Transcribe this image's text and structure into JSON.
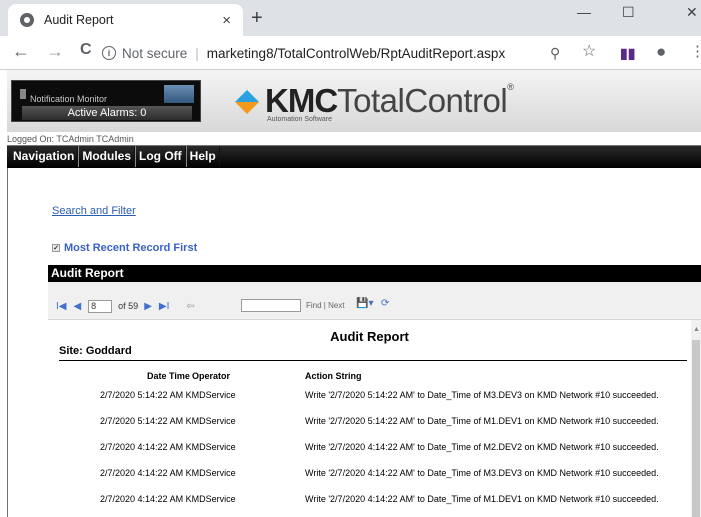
{
  "browser": {
    "tab_title": "Audit Report",
    "new_tab": "+",
    "url_security": "Not secure",
    "url": "marketing8/TotalControlWeb/RptAuditReport.aspx"
  },
  "header": {
    "notification_label": "Notification Monitor",
    "active_alarms": "Active Alarms: 0",
    "brand_bold": "KMC",
    "brand_light": "TotalControl",
    "brand_sub": "Automation Software"
  },
  "logged_on": "Logged On: TCAdmin TCAdmin",
  "menu": [
    "Navigation",
    "Modules",
    "Log Off",
    "Help"
  ],
  "search_link": "Search and Filter",
  "recent_label": "Most Recent Record First",
  "audit_title": "Audit Report",
  "toolbar": {
    "page": "8",
    "of_pages": "of 59",
    "find": "Find",
    "next": "Next",
    "find_sep": "|"
  },
  "report": {
    "title": "Audit Report",
    "site": "Site: Goddard",
    "col_datetime": "Date Time",
    "col_operator": "Operator",
    "col_action": "Action String",
    "rows": [
      {
        "datetime": "2/7/2020 5:14:22 AM",
        "operator": "KMDService",
        "action": "Write '2/7/2020 5:14:22 AM' to Date_Time of M3.DEV3 on KMD Network #10 succeeded."
      },
      {
        "datetime": "2/7/2020 5:14:22 AM",
        "operator": "KMDService",
        "action": "Write '2/7/2020 5:14:22 AM' to Date_Time of M1.DEV1 on KMD Network #10 succeeded."
      },
      {
        "datetime": "2/7/2020 4:14:22 AM",
        "operator": "KMDService",
        "action": "Write '2/7/2020 4:14:22 AM' to Date_Time of M2.DEV2 on KMD Network #10 succeeded."
      },
      {
        "datetime": "2/7/2020 4:14:22 AM",
        "operator": "KMDService",
        "action": "Write '2/7/2020 4:14:22 AM' to Date_Time of M3.DEV3 on KMD Network #10 succeeded."
      },
      {
        "datetime": "2/7/2020 4:14:22 AM",
        "operator": "KMDService",
        "action": "Write '2/7/2020 4:14:22 AM' to Date_Time of M1.DEV1 on KMD Network #10 succeeded."
      }
    ]
  },
  "icons": {
    "favicon": "globe-icon",
    "tab_close": "×",
    "back": "←",
    "forward": "→",
    "reload": "C",
    "zoom": "magnifier-icon",
    "star": "☆",
    "account": "account-icon",
    "kebab": "⋮",
    "first": "I◀",
    "prev": "◀",
    "next": "▶",
    "last": "▶I",
    "back_nav": "⇦",
    "export": "export-icon",
    "refresh": "refresh-icon"
  },
  "colors": {
    "link": "#2a5db0",
    "menubar": "#000000",
    "logo_blue": "#2aa1e0",
    "logo_orange": "#f39a1e"
  }
}
